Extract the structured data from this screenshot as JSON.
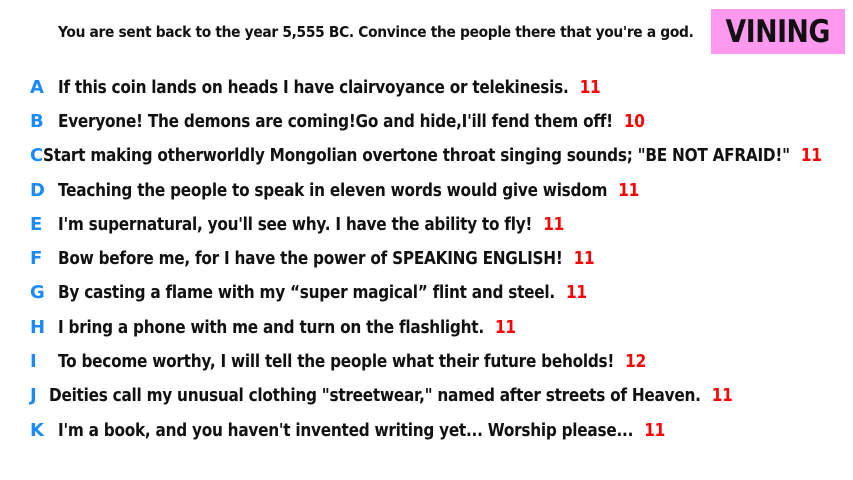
{
  "prompt": "You are sent back to the year 5,555 BC. Convince the people there that you're a god.",
  "badge": "VINING",
  "colors": {
    "letter": "#1a8bff",
    "count": "#ff0000",
    "badge_bg": "#ff99f0",
    "text": "#111111"
  },
  "entries": [
    {
      "letter": "A",
      "text": "If this coin lands on heads I have clairvoyance or telekinesis.",
      "count": "11"
    },
    {
      "letter": "B",
      "text": "Everyone! The demons are coming!Go and hide,I'ill fend them off!",
      "count": "10"
    },
    {
      "letter": "C",
      "text": "Start making otherworldly Mongolian overtone throat singing sounds; \"BE NOT AFRAID!\"",
      "count": "11"
    },
    {
      "letter": "D",
      "text": "Teaching the people to speak in eleven words would give wisdom",
      "count": "11"
    },
    {
      "letter": "E",
      "text": "I'm supernatural, you'll see why. I have the ability to fly!",
      "count": "11"
    },
    {
      "letter": "F",
      "text": "Bow before me, for I have the power of SPEAKING ENGLISH!",
      "count": "11"
    },
    {
      "letter": "G",
      "text": "By casting a flame with my “super magical” flint and steel.",
      "count": "11"
    },
    {
      "letter": "H",
      "text": "I bring a phone with me and turn on the flashlight.",
      "count": "11"
    },
    {
      "letter": "I",
      "text": "To become worthy, I will tell the people what their future beholds!",
      "count": "12"
    },
    {
      "letter": "J",
      "text": "Deities call my unusual clothing \"streetwear,\" named after streets of Heaven.",
      "count": "11"
    },
    {
      "letter": "K",
      "text": "I'm a book, and you haven't invented writing yet... Worship please...",
      "count": "11"
    }
  ]
}
